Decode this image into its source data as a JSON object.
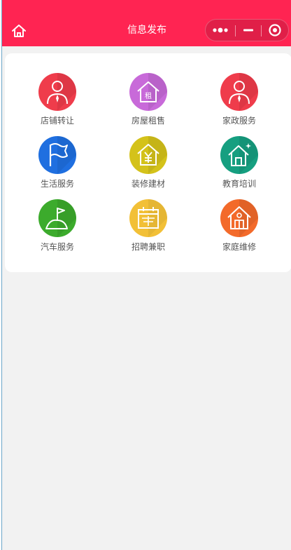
{
  "header": {
    "title": "信息发布",
    "background": "#ff2452",
    "home_icon": "home-icon",
    "capsule": {
      "more_icon": "more-icon",
      "minimize_icon": "minimize-icon",
      "close_icon": "target-icon"
    }
  },
  "categories": [
    {
      "label": "店铺转让",
      "icon": "businessman-icon",
      "color": "#ef3c4b"
    },
    {
      "label": "房屋租售",
      "icon": "house-rent-icon",
      "color": "#c86ad9"
    },
    {
      "label": "家政服务",
      "icon": "businessman-icon",
      "color": "#ef3c4b"
    },
    {
      "label": "生活服务",
      "icon": "flag-icon",
      "color": "#1f6fe0"
    },
    {
      "label": "装修建材",
      "icon": "house-yuan-icon",
      "color": "#d4c21a"
    },
    {
      "label": "教育培训",
      "icon": "house-star-icon",
      "color": "#169f80"
    },
    {
      "label": "汽车服务",
      "icon": "flag-hill-icon",
      "color": "#3cab2c"
    },
    {
      "label": "招聘兼职",
      "icon": "calendar-icon",
      "color": "#f2c037"
    },
    {
      "label": "家庭维修",
      "icon": "house-tools-icon",
      "color": "#f36a2a"
    }
  ]
}
